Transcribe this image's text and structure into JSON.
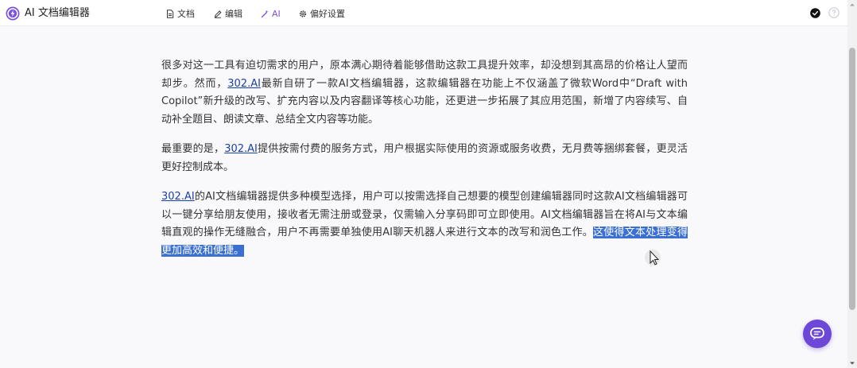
{
  "app": {
    "title": "AI 文档编辑器",
    "accent_color": "#7b4fe0",
    "logo_icon": "purple-lightning-logo"
  },
  "nav": {
    "doc_label": "文档",
    "edit_label": "编辑",
    "ai_label": "AI",
    "settings_label": "偏好设置",
    "active": "ai"
  },
  "header_right": {
    "status_icon": "check-circle-icon",
    "help_icon": "help-circle-icon"
  },
  "document": {
    "p1": {
      "part1": "很多对这一工具有迫切需求的用户，原本满心期待着能够借助这款工具提升效率，却没想到其高昂的价格让人望而却步。然而，",
      "link": "302.AI",
      "part2": "最新自研了一款AI文档编辑器，这款编辑器在功能上不仅涵盖了微软Word中“Draft with Copilot”新升级的改写、扩充内容以及内容翻译等核心功能，还更进一步拓展了其应用范围，新增了内容续写、自动补全题目、朗读文章、总结全文内容等功能。"
    },
    "p2": {
      "part1": "最重要的是，",
      "link": "302.AI",
      "part2": "提供按需付费的服务方式，用户根据实际使用的资源或服务收费，无月费等捆绑套餐，更灵活更好控制成本。"
    },
    "p3": {
      "link": "302.AI",
      "part1": "的AI文档编辑器提供多种模型选择，用户可以按需选择自己想要的模型创建编辑器同时这款AI文档编辑器可以一键分享给朋友使用，接收者无需注册或登录，仅需输入分享码即可立即使用。AI文档编辑器旨在将AI与文本编辑直观的操作无缝融合，用户不再需要单独使用AI聊天机器人来进行文本的改写和润色工作。",
      "selected": "这使得文本处理变得更加高效和便捷。"
    }
  },
  "chat_button": {
    "icon": "chat-bubble-icon"
  }
}
